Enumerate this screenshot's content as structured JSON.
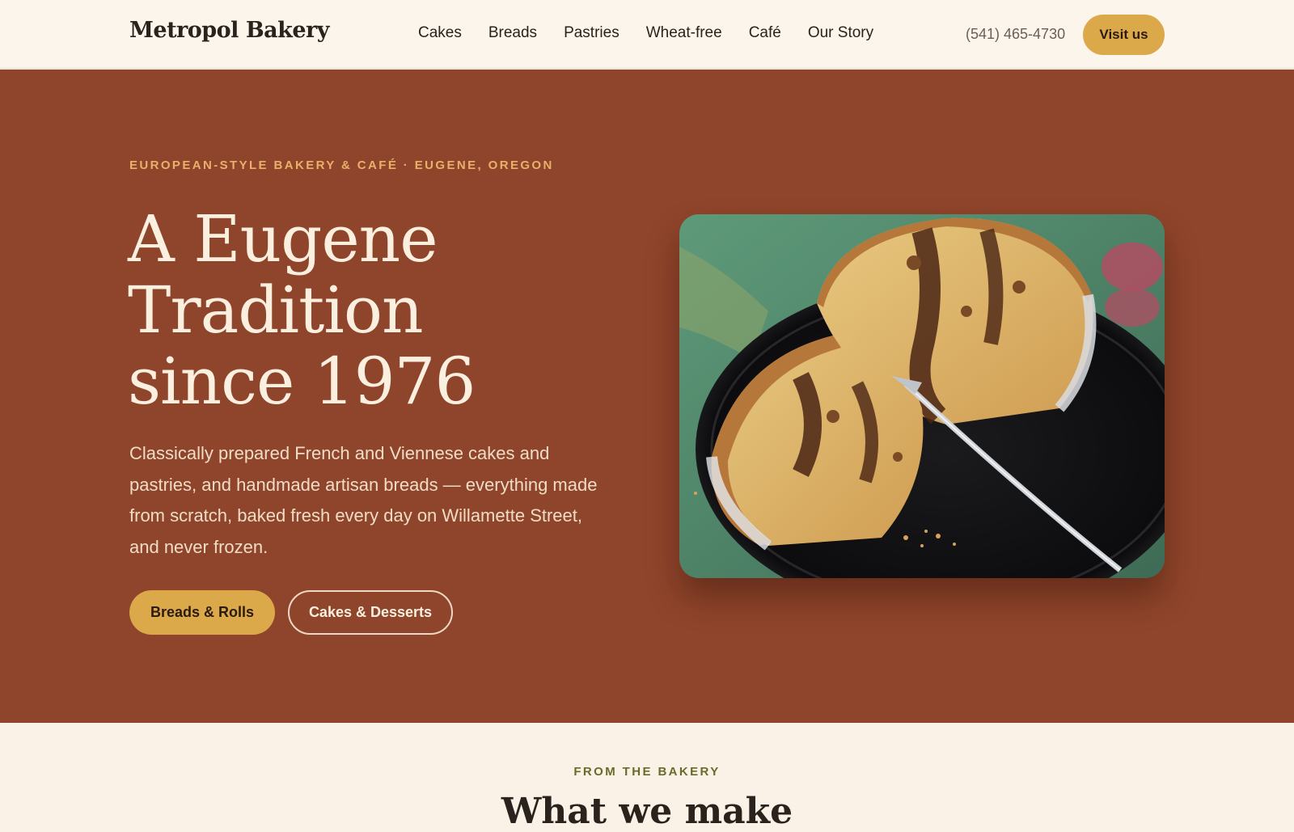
{
  "nav": {
    "brand": "Metropol Bakery",
    "links": [
      "Cakes",
      "Breads",
      "Pastries",
      "Wheat-free",
      "Café",
      "Our Story"
    ],
    "phone": "(541) 465-4730",
    "cta": "Visit us"
  },
  "hero": {
    "eyebrow": "EUROPEAN-STYLE BAKERY & CAFÉ · EUGENE, OREGON",
    "headline_lines": [
      "A Eugene",
      "Tradition",
      "since 1976"
    ],
    "lede": "Classically prepared French and Viennese cakes and pastries, and handmade artisan breads — everything made from scratch, baked fresh every day on Willamette Street, and never frozen.",
    "primary_button": "Breads & Rolls",
    "secondary_button": "Cakes & Desserts"
  },
  "section": {
    "eyebrow": "FROM THE BAKERY",
    "title": "What we make"
  },
  "colors": {
    "hero_bg": "#8f452b",
    "accent_gold": "#dca94a",
    "cream": "#faf2e6",
    "eyebrow_orange": "#eab06a",
    "olive": "#6b6a2a"
  }
}
